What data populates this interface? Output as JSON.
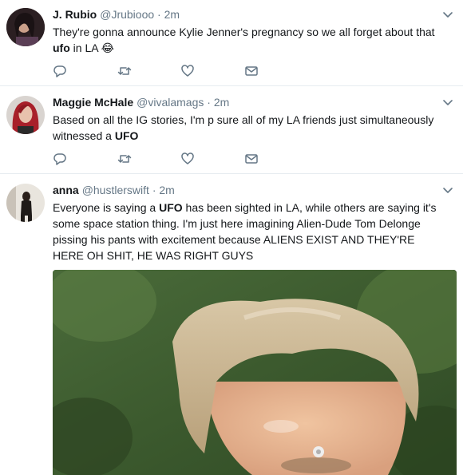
{
  "tweets": [
    {
      "name": "J. Rubio",
      "handle": "@Jrubiooo",
      "time": "2m",
      "text_before": "They're gonna announce Kylie Jenner's pregnancy so we all forget about that ",
      "keyword": "ufo",
      "text_after": " in LA 😂"
    },
    {
      "name": "Maggie McHale",
      "handle": "@vivalamags",
      "time": "2m",
      "text_before": "Based on all the IG stories, I'm p sure all of my LA friends just simultaneously witnessed a ",
      "keyword": "UFO",
      "text_after": ""
    },
    {
      "name": "anna",
      "handle": "@hustlerswift",
      "time": "2m",
      "text_before": "Everyone is saying a ",
      "keyword": "UFO",
      "text_after": " has been sighted in LA, while others are saying it's some space station thing. I'm just here imagining Alien-Dude Tom Delonge pissing his pants with excitement because ALIENS EXIST AND THEY'RE HERE OH SHIT, HE WAS RIGHT GUYS"
    }
  ],
  "separator": "·",
  "icons": {
    "reply": "reply-icon",
    "retweet": "retweet-icon",
    "like": "heart-icon",
    "message": "envelope-icon",
    "more": "chevron-down-icon"
  },
  "colors": {
    "name": "#14171a",
    "secondary": "#657786",
    "icon": "#657786",
    "divider": "#e6ecf0"
  }
}
